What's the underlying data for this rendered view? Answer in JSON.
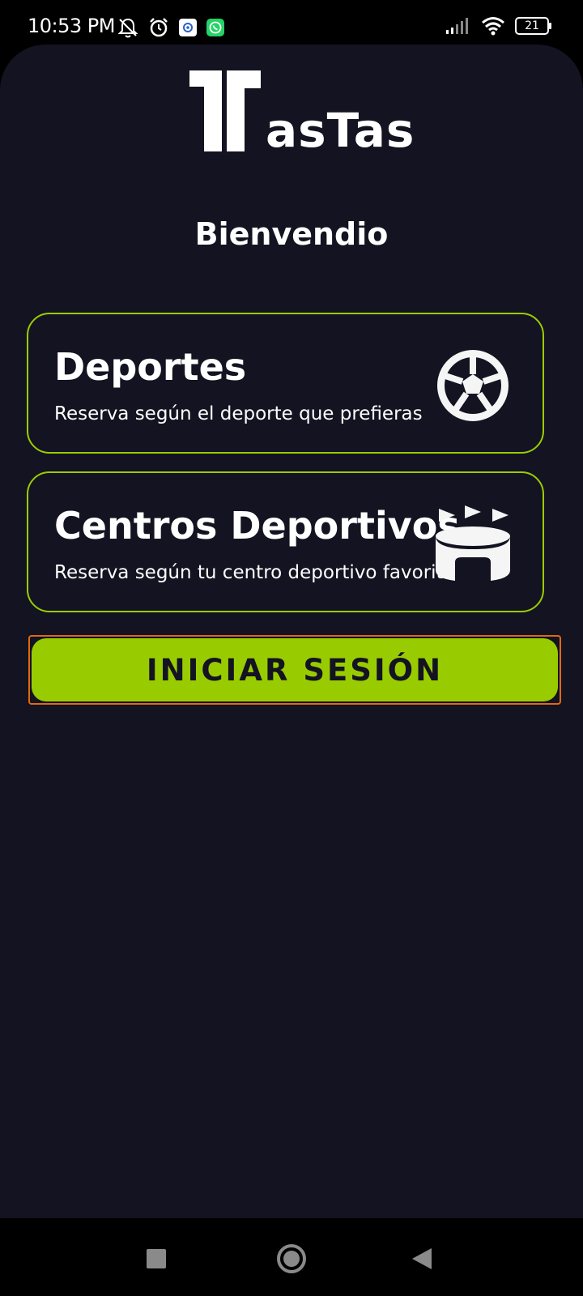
{
  "status_bar": {
    "time": "10:53 PM",
    "battery": "21",
    "icons_left": [
      "mute-bell-icon",
      "alarm-icon",
      "app-notification-icon",
      "whatsapp-icon"
    ],
    "icons_right": [
      "signal-icon",
      "wifi-icon",
      "battery-icon"
    ]
  },
  "app": {
    "logo_text": "asTas",
    "welcome": "Bienvendio",
    "cards": [
      {
        "title": "Deportes",
        "subtitle": "Reserva según el deporte que prefieras",
        "icon": "soccer-ball-icon"
      },
      {
        "title": "Centros Deportivos",
        "subtitle": "Reserva según tu centro deportivo favorito",
        "icon": "stadium-icon"
      }
    ],
    "login_button": "INICIAR SESIÓN"
  },
  "nav_bar": {
    "buttons": [
      "recents-icon",
      "home-icon",
      "back-icon"
    ]
  },
  "colors": {
    "background": "#131321",
    "accent": "#99cc00",
    "focus_border": "#e06a10",
    "text": "#ffffff"
  }
}
